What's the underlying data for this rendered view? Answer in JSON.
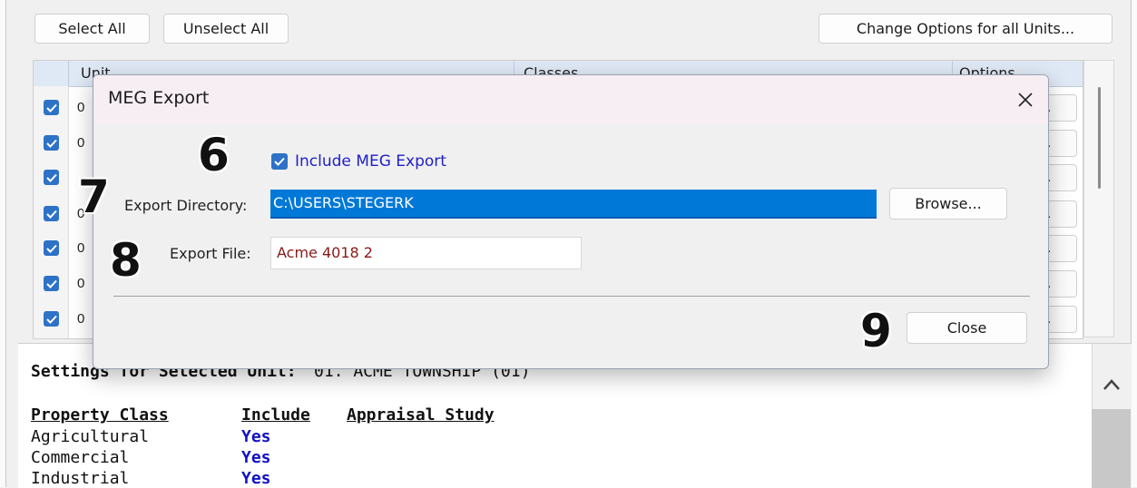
{
  "toolbar": {
    "select_all": "Select All",
    "unselect_all": "Unselect All",
    "change_options": "Change Options for all Units..."
  },
  "grid": {
    "headers": [
      "Unit",
      "Classes",
      "Options"
    ],
    "rows": [
      {
        "unit": "0",
        "checked": true,
        "option": "."
      },
      {
        "unit": "0",
        "checked": true,
        "option": "."
      },
      {
        "unit": "",
        "checked": true,
        "option": "."
      },
      {
        "unit": "0",
        "checked": true,
        "option": "."
      },
      {
        "unit": "0",
        "checked": true,
        "option": "."
      },
      {
        "unit": "0",
        "checked": true,
        "option": "."
      },
      {
        "unit": "0",
        "checked": true,
        "option": "."
      }
    ]
  },
  "settings": {
    "title": "Settings for Selected Unit:",
    "unit": "01. ACME TOWNSHIP (01)",
    "headers": {
      "property_class": "Property Class",
      "include": "Include",
      "appraisal_study": "Appraisal Study"
    },
    "rows": [
      {
        "class": "Agricultural",
        "include": "Yes"
      },
      {
        "class": "Commercial",
        "include": "Yes"
      },
      {
        "class": "Industrial",
        "include": "Yes"
      }
    ]
  },
  "dialog": {
    "title": "MEG Export",
    "include_label": "Include MEG Export",
    "include_checked": true,
    "dir_label": "Export Directory:",
    "dir_value": "C:\\USERS\\STEGERK",
    "browse": "Browse...",
    "file_label": "Export File:",
    "file_value": "Acme 4018 2",
    "close": "Close"
  },
  "callouts": [
    "6",
    "7",
    "8",
    "9"
  ],
  "colors": {
    "accent": "#2e72c8",
    "selection": "#0078d7",
    "yes": "#1010c8",
    "file_text": "#8b1818"
  }
}
